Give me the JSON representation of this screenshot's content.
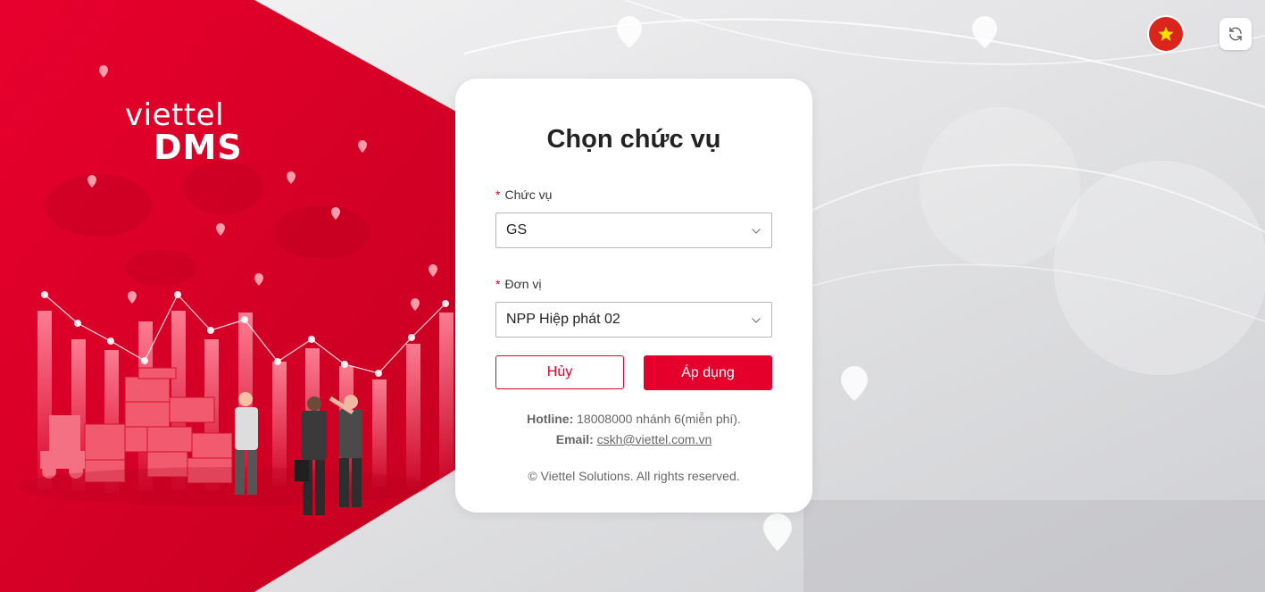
{
  "brand": {
    "line1": "viettel",
    "line2": "DMS"
  },
  "topbar": {
    "language_icon": "vietnam-flag-icon",
    "refresh_icon": "refresh-icon"
  },
  "form": {
    "title": "Chọn chức vụ",
    "required_mark": "*",
    "position": {
      "label": "Chức vụ",
      "value": "GS"
    },
    "unit": {
      "label": "Đơn vị",
      "value": "NPP Hiệp phát 02"
    },
    "cancel_label": "Hủy",
    "apply_label": "Áp dụng"
  },
  "footer": {
    "hotline_label": "Hotline:",
    "hotline_value": "18008000 nhánh 6(miễn phí).",
    "email_label": "Email:",
    "email_value": "cskh@viettel.com.vn",
    "copyright": "© Viettel Solutions. All rights reserved."
  },
  "colors": {
    "brand_red": "#e4002b",
    "text_dark": "#222222",
    "muted": "#666666"
  }
}
